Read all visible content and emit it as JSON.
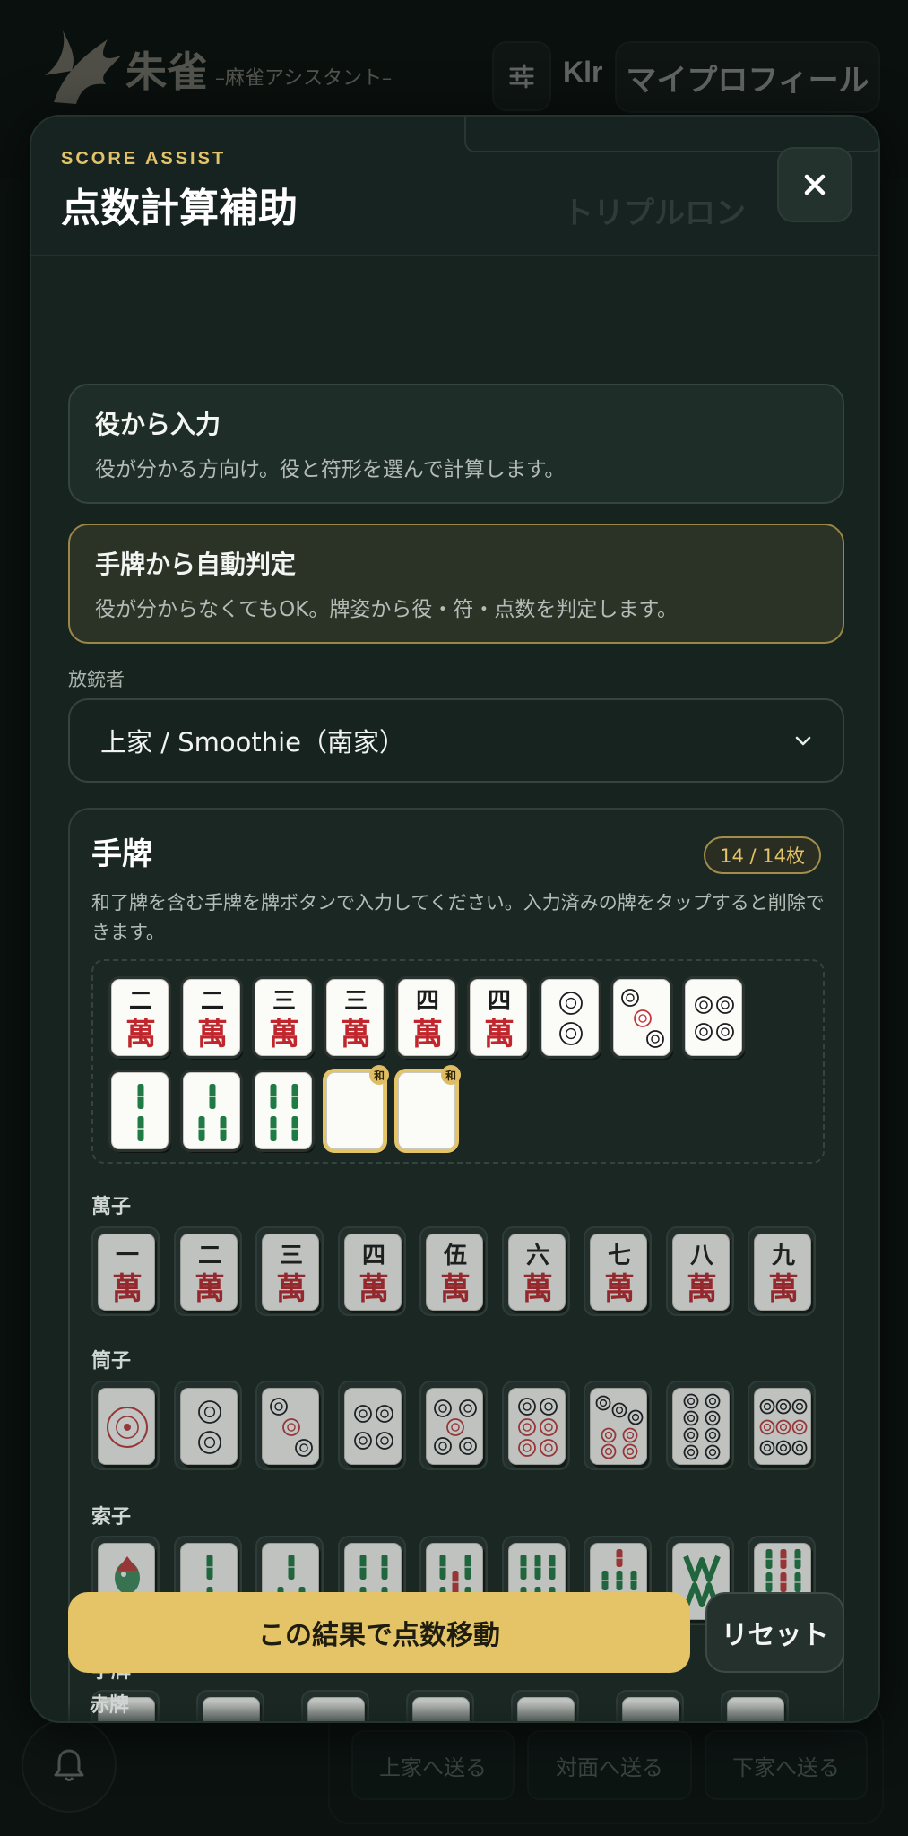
{
  "app": {
    "logo_title": "朱雀",
    "logo_subtitle": "–麻雀アシスタント–",
    "user_name": "Klr",
    "profile_button": "マイプロフィール"
  },
  "background": {
    "ghost_text": "トリプルロン",
    "send_buttons": [
      "上家へ送る",
      "対面へ送る",
      "下家へ送る"
    ]
  },
  "modal": {
    "eyebrow": "SCORE ASSIST",
    "title": "点数計算補助",
    "close_label": "×"
  },
  "modes": [
    {
      "title": "役から入力",
      "desc": "役が分かる方向け。役と符形を選んで計算します。",
      "active": false
    },
    {
      "title": "手牌から自動判定",
      "desc": "役が分からなくてもOK。牌姿から役・符・点数を判定します。",
      "active": true
    }
  ],
  "discarder": {
    "label": "放銃者",
    "value": "上家 / Smoothie（南家）"
  },
  "hand": {
    "title": "手牌",
    "count": "14 / 14枚",
    "help": "和了牌を含む手牌を牌ボタンで入力してください。入力済みの牌をタップすると削除できます。",
    "win_badge": "和",
    "tiles": [
      "2m",
      "2m",
      "3m",
      "3m",
      "4m",
      "4m",
      "2p",
      "3p",
      "4p",
      "2s",
      "3s",
      "4s",
      "haku",
      "haku"
    ],
    "winning_tiles": [
      12,
      13
    ]
  },
  "palette": {
    "manzu_label": "萬子",
    "pinzu_label": "筒子",
    "souzu_label": "索子",
    "jihai_label": "字牌",
    "aka_label": "赤牌",
    "man_kanji": [
      "一",
      "二",
      "三",
      "四",
      "伍",
      "六",
      "七",
      "八",
      "九"
    ],
    "man_suffix": "萬"
  },
  "actions": {
    "apply": "この結果で点数移動",
    "reset": "リセット"
  },
  "colors": {
    "accent": "#e4c466",
    "background": "#17231f",
    "man_red": "#c0262c",
    "sou_green": "#1f7a44",
    "pin_red": "#c43a3a"
  }
}
